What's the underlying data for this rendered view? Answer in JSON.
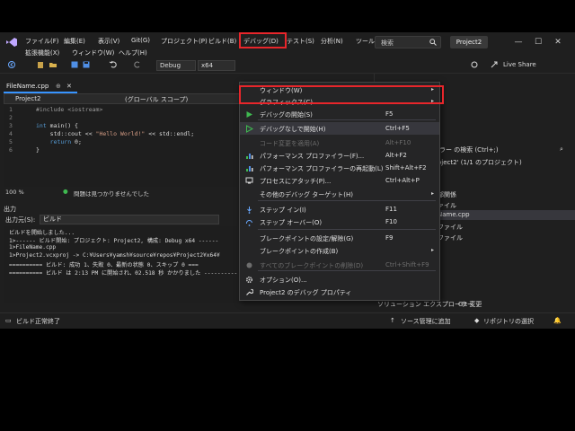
{
  "menubar": {
    "items": [
      "ファイル(F)",
      "編集(E)",
      "表示(V)",
      "Git(G)",
      "プロジェクト(P)",
      "ビルド(B)",
      "デバッグ(D)",
      "テスト(S)",
      "分析(N)",
      "ツール(T)"
    ],
    "items2": [
      "拡張機能(X)",
      "ウィンドウ(W)",
      "ヘルプ(H)"
    ],
    "search_label": "検索",
    "solution_name": "Project2"
  },
  "toolbar": {
    "config": "Debug",
    "platform": "x64",
    "live_share": "Live Share"
  },
  "editor": {
    "tab_label": "FileName.cpp",
    "project_combo": "Project2",
    "scope_combo": "(グローバル スコープ)",
    "code": [
      {
        "ln": "1",
        "text": "#include <iostream>"
      },
      {
        "ln": "2",
        "text": ""
      },
      {
        "ln": "3",
        "text": "int main() {"
      },
      {
        "ln": "4",
        "text": "    std::cout << \"Hello World!\" << std::endl;"
      },
      {
        "ln": "5",
        "text": "    return 0;"
      },
      {
        "ln": "6",
        "text": "}"
      }
    ],
    "zoom": "100 %",
    "issues": "問題は見つかりませんでした"
  },
  "output": {
    "title": "出力",
    "source_label": "出力元(S):",
    "source_value": "ビルド",
    "lines": [
      "ビルドを開始しました...",
      "1>------ ビルド開始: プロジェクト: Project2, 構成: Debug x64 ------",
      "1>FileName.cpp",
      "1>Project2.vcxproj -> C:¥Users¥yamsh¥source¥repos¥Project2¥x64¥",
      "========== ビルド: 成功 1、失敗 0、最新の状態 0、スキップ 0 ===",
      "========== ビルド は 2:13 PM に開始され、02.518 秒 かかりました ----------"
    ]
  },
  "solution_explorer": {
    "search_text": "ラー の検索 (Ctrl+;)",
    "title_line": "oject2' (1/1 のプロジェクト)",
    "nodes": [
      "部関係",
      "ァイル",
      "Name.cpp",
      "ファイル",
      "ファイル"
    ],
    "tab_solution": "ソリューション エクスプローラー",
    "tab_git": "Git 変更"
  },
  "statusbar": {
    "left": "ビルド正常終了",
    "source_control": "ソース管理に追加",
    "repo": "リポジトリの選択"
  },
  "debug_menu": {
    "items": [
      {
        "label": "ウィンドウ(W)",
        "shortcut": "",
        "submenu": true,
        "icon": "none",
        "disabled": false
      },
      {
        "label": "グラフィックス(C)",
        "shortcut": "",
        "submenu": true,
        "icon": "none",
        "disabled": false
      },
      {
        "label": "デバッグの開始(S)",
        "shortcut": "F5",
        "submenu": false,
        "icon": "play",
        "disabled": false
      },
      {
        "label": "デバッグなしで開始(H)",
        "shortcut": "Ctrl+F5",
        "submenu": false,
        "icon": "play-outline",
        "disabled": false
      },
      {
        "label": "コード変更を適用(A)",
        "shortcut": "Alt+F10",
        "submenu": false,
        "icon": "none",
        "disabled": true
      },
      {
        "label": "パフォーマンス プロファイラー(F)...",
        "shortcut": "Alt+F2",
        "submenu": false,
        "icon": "perf",
        "disabled": false
      },
      {
        "label": "パフォーマンス プロファイラーの再起動(L)",
        "shortcut": "Shift+Alt+F2",
        "submenu": false,
        "icon": "perf",
        "disabled": false
      },
      {
        "label": "プロセスにアタッチ(P)...",
        "shortcut": "Ctrl+Alt+P",
        "submenu": false,
        "icon": "attach",
        "disabled": false
      },
      {
        "label": "その他のデバッグ ターゲット(H)",
        "shortcut": "",
        "submenu": true,
        "icon": "none",
        "disabled": false
      },
      {
        "label": "ステップ イン(I)",
        "shortcut": "F11",
        "submenu": false,
        "icon": "step-in",
        "disabled": false
      },
      {
        "label": "ステップ オーバー(O)",
        "shortcut": "F10",
        "submenu": false,
        "icon": "step-over",
        "disabled": false
      },
      {
        "label": "ブレークポイントの設定/解除(G)",
        "shortcut": "F9",
        "submenu": false,
        "icon": "none",
        "disabled": false
      },
      {
        "label": "ブレークポイントの作成(B)",
        "shortcut": "",
        "submenu": true,
        "icon": "none",
        "disabled": false
      },
      {
        "label": "すべてのブレークポイントの削除(D)",
        "shortcut": "Ctrl+Shift+F9",
        "submenu": false,
        "icon": "bp",
        "disabled": true
      },
      {
        "label": "オプション(O)...",
        "shortcut": "",
        "submenu": false,
        "icon": "gear",
        "disabled": false
      },
      {
        "label": "Project2 のデバッグ プロパティ",
        "shortcut": "",
        "submenu": false,
        "icon": "wrench",
        "disabled": false
      }
    ]
  },
  "colors": {
    "highlight": "#e8262b",
    "accent": "#3794ff"
  }
}
